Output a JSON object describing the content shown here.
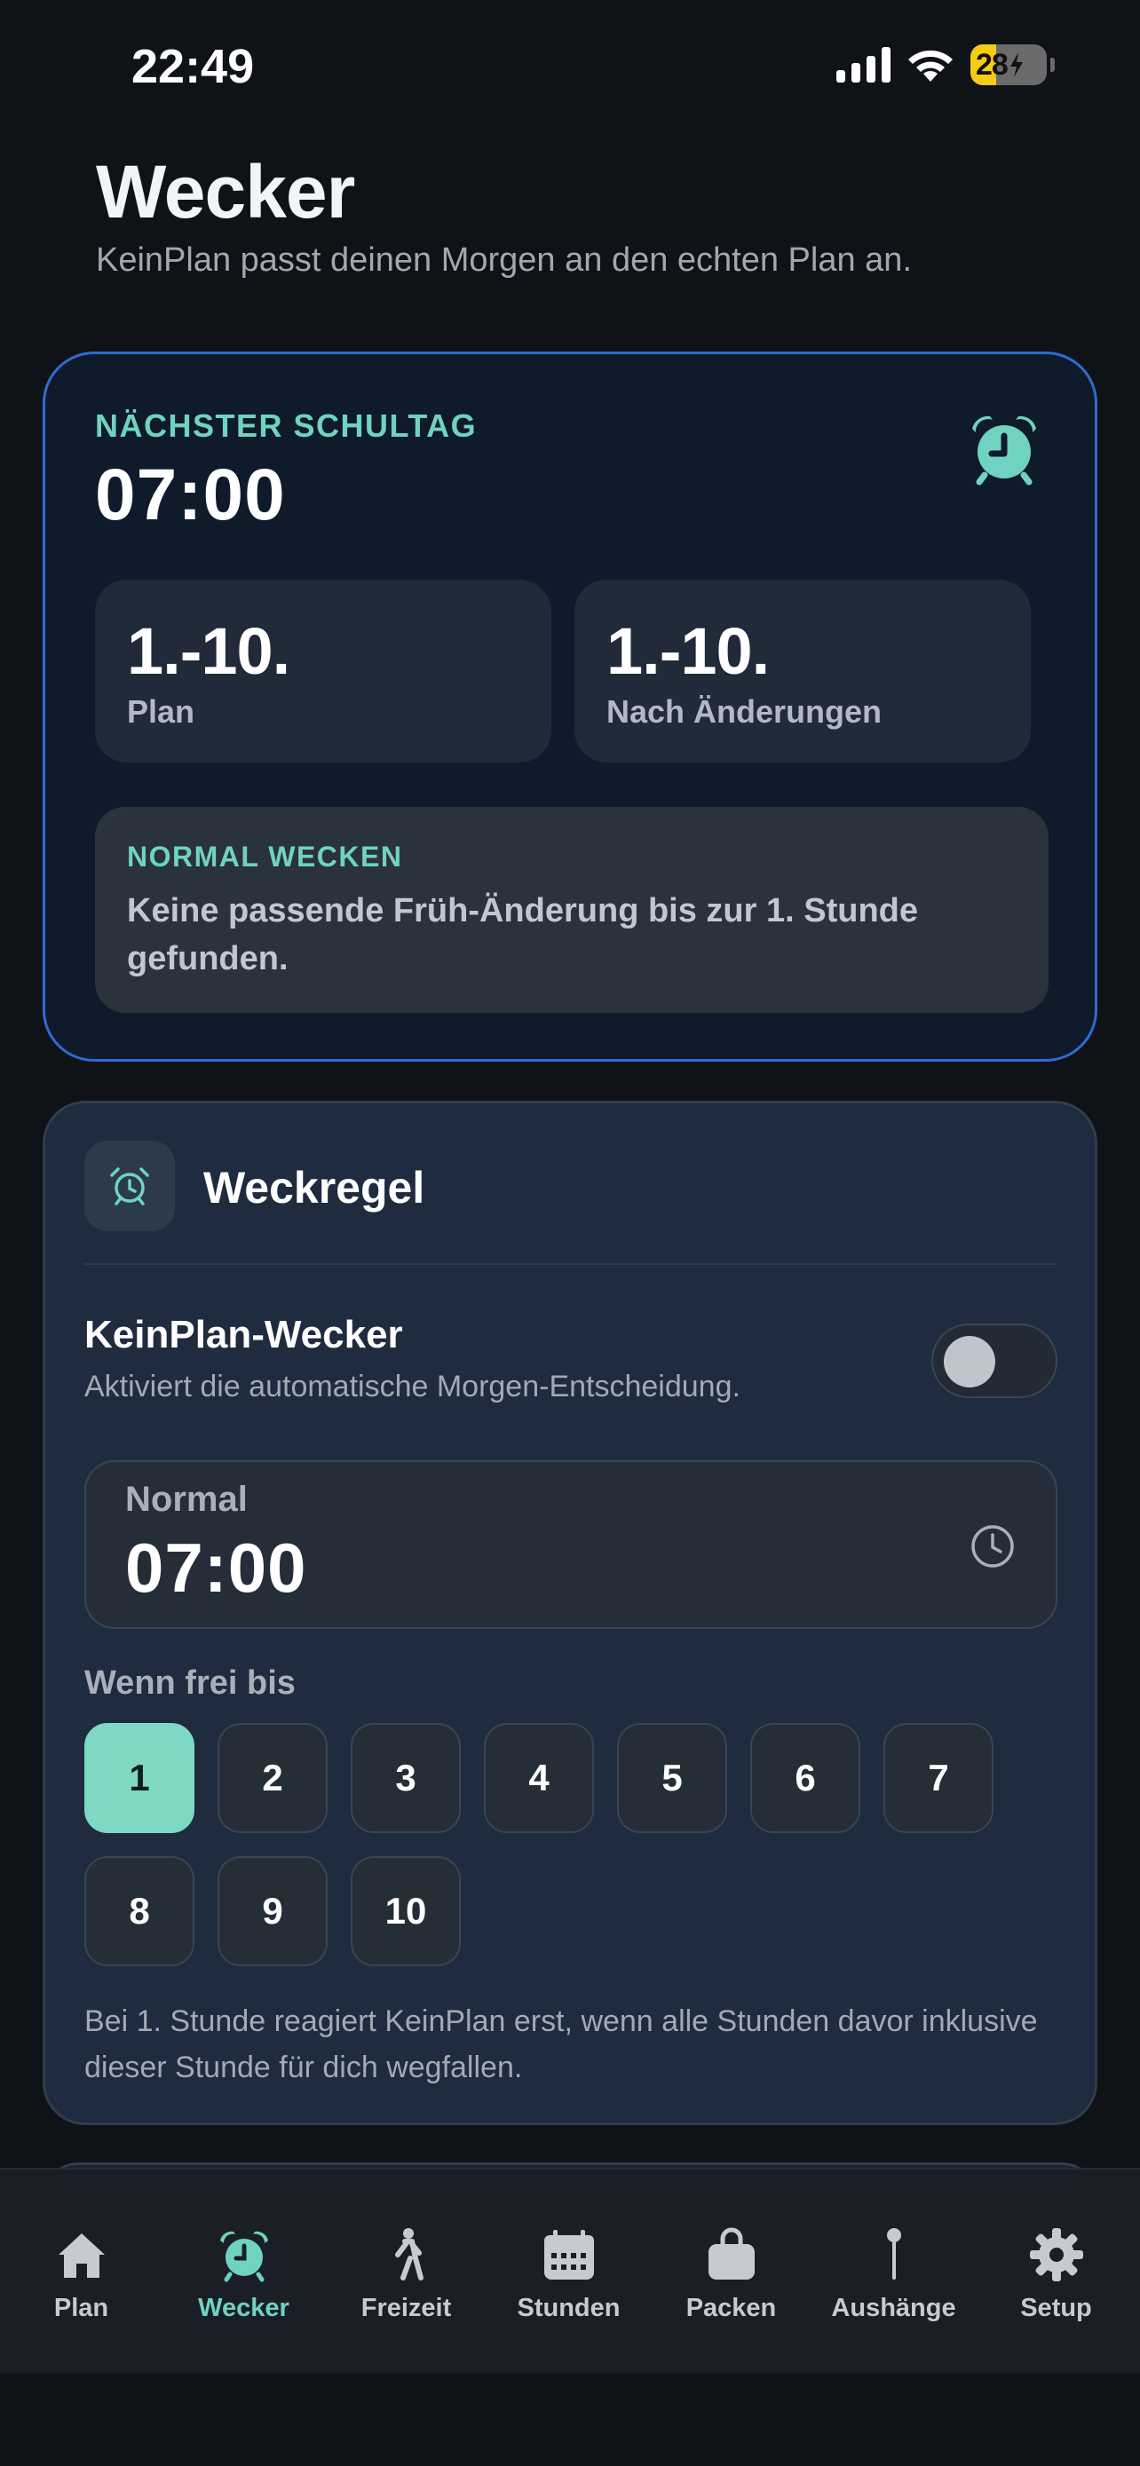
{
  "status_bar": {
    "time": "22:49",
    "battery": "28"
  },
  "header": {
    "title": "Wecker",
    "subtitle": "KeinPlan passt deinen Morgen an den echten Plan an."
  },
  "hero": {
    "eyebrow": "NÄCHSTER SCHULTAG",
    "time": "07:00",
    "stats": [
      {
        "value": "1.-10.",
        "label": "Plan"
      },
      {
        "value": "1.-10.",
        "label": "Nach Änderungen"
      }
    ],
    "notice": {
      "title": "NORMAL WECKEN",
      "text": "Keine passende Früh-Änderung bis zur 1. Stunde gefunden."
    }
  },
  "rule": {
    "title": "Weckregel",
    "toggle_title": "KeinPlan-Wecker",
    "toggle_desc": "Aktiviert die automatische Morgen-Entscheidung.",
    "toggle_on": false,
    "time_label": "Normal",
    "time_value": "07:00",
    "free_label": "Wenn frei bis",
    "periods": [
      "1",
      "2",
      "3",
      "4",
      "5",
      "6",
      "7",
      "8",
      "9",
      "10"
    ],
    "selected_period": "1",
    "note": "Bei 1. Stunde reagiert KeinPlan erst, wenn alle Stunden davor inklusive dieser Stunde für dich wegfallen."
  },
  "tabs": [
    {
      "label": "Plan",
      "icon": "home-icon"
    },
    {
      "label": "Wecker",
      "icon": "alarm-clock-icon",
      "active": true
    },
    {
      "label": "Freizeit",
      "icon": "walking-icon"
    },
    {
      "label": "Stunden",
      "icon": "calendar-icon"
    },
    {
      "label": "Packen",
      "icon": "bag-icon"
    },
    {
      "label": "Aushänge",
      "icon": "pin-icon"
    },
    {
      "label": "Setup",
      "icon": "gear-icon"
    }
  ],
  "colors": {
    "accent": "#6fd3bf",
    "hero_border": "#2e6bd3",
    "background": "#0f1217"
  }
}
